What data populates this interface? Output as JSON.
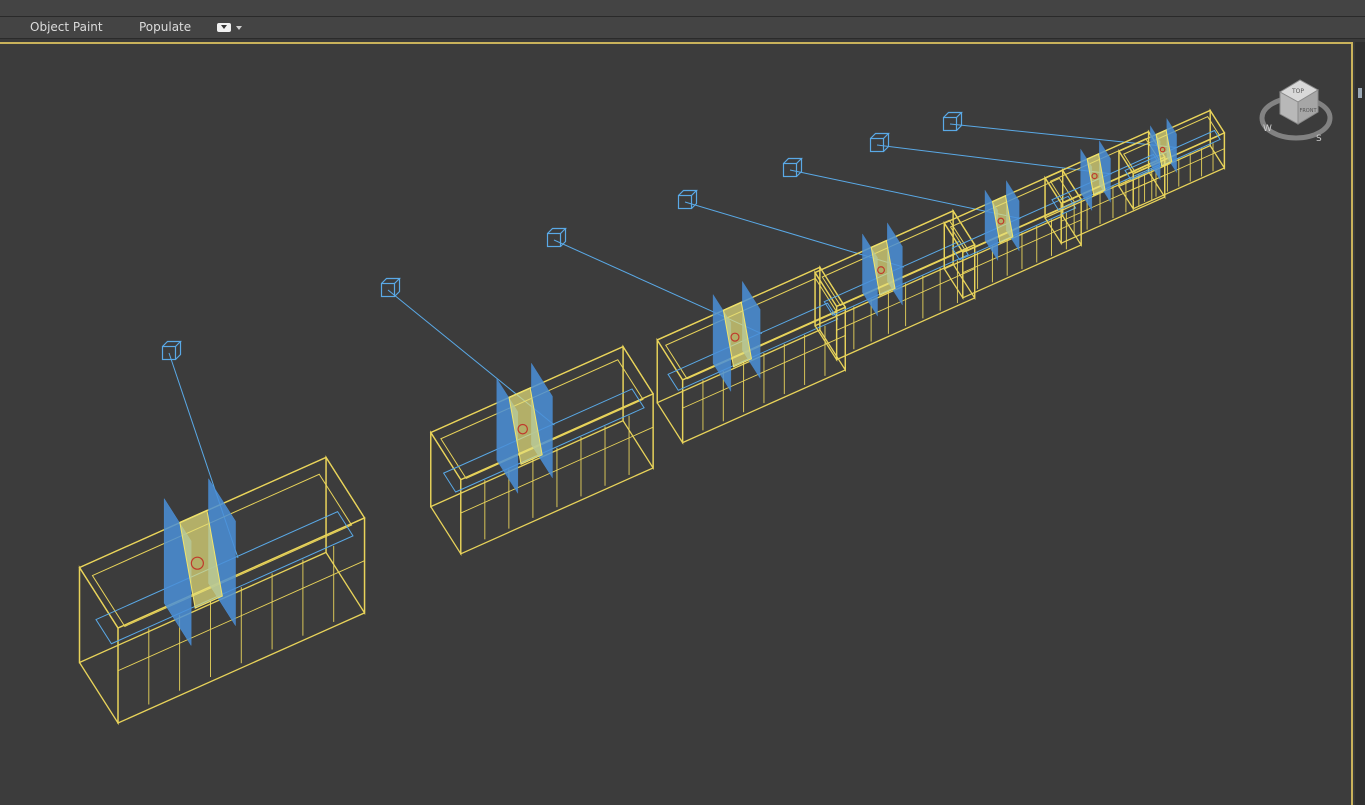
{
  "ribbon": {
    "tabs": [
      {
        "label": "Object Paint"
      },
      {
        "label": "Populate"
      }
    ],
    "dropdown_icon": "chevron-down-icon"
  },
  "viewcube": {
    "labels": {
      "top": "TOP",
      "front": "FRONT",
      "west": "W",
      "south": "S"
    }
  },
  "colors": {
    "viewport_bg": "#3c3c3c",
    "wire_yellow": "#e8d35a",
    "wire_blue": "#5aa9e6",
    "panel_blue": "#4a8fd8",
    "active_border": "#c9b25b"
  }
}
